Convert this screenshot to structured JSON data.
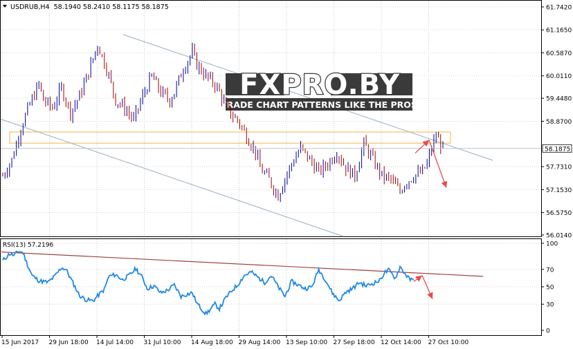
{
  "chart_data": [
    {
      "type": "candlestick",
      "symbol_header": "USDRUB,H4  58.1940 58.2410 58.1175 58.1875",
      "header_menu_icon": "triangle-down-icon",
      "current_price": 58.1875,
      "current_price_label": "58.1875",
      "y_ticks": [
        "61.7420",
        "61.1650",
        "60.5870",
        "60.0110",
        "59.4480",
        "58.8700",
        "57.7310",
        "57.1530",
        "56.5750",
        "56.0140"
      ],
      "ylim": [
        56.014,
        61.742
      ],
      "x_labels": [
        "15 Jun 2017",
        "29 Jun 18:00",
        "14 Jul 14:00",
        "31 Jul 10:00",
        "14 Aug 18:00",
        "29 Aug 14:00",
        "13 Sep 10:00",
        "27 Sep 18:00",
        "12 Oct 14:00",
        "27 Oct 10:00"
      ],
      "bull_color": "#0000a0",
      "bear_color": "#a00000",
      "grid": true,
      "close_path": [
        [
          0,
          57.5
        ],
        [
          4,
          57.9
        ],
        [
          8,
          58.7
        ],
        [
          12,
          59.3
        ],
        [
          16,
          59.8
        ],
        [
          18,
          59.4
        ],
        [
          22,
          59.2
        ],
        [
          26,
          59.7
        ],
        [
          30,
          59.1
        ],
        [
          34,
          59.5
        ],
        [
          38,
          60.1
        ],
        [
          42,
          60.8
        ],
        [
          46,
          60.2
        ],
        [
          50,
          59.4
        ],
        [
          54,
          59.2
        ],
        [
          58,
          58.9
        ],
        [
          62,
          59.5
        ],
        [
          66,
          60.0
        ],
        [
          70,
          59.6
        ],
        [
          74,
          59.4
        ],
        [
          76,
          59.6
        ],
        [
          80,
          60.2
        ],
        [
          84,
          60.6
        ],
        [
          86,
          60.3
        ],
        [
          90,
          60.0
        ],
        [
          94,
          59.8
        ],
        [
          96,
          59.6
        ],
        [
          100,
          59.1
        ],
        [
          104,
          58.9
        ],
        [
          108,
          58.5
        ],
        [
          112,
          58.1
        ],
        [
          114,
          57.7
        ],
        [
          118,
          57.4
        ],
        [
          122,
          57.0
        ],
        [
          124,
          57.3
        ],
        [
          128,
          57.8
        ],
        [
          132,
          58.2
        ],
        [
          136,
          57.9
        ],
        [
          140,
          57.6
        ],
        [
          144,
          57.8
        ],
        [
          148,
          58.1
        ],
        [
          152,
          57.7
        ],
        [
          156,
          57.5
        ],
        [
          158,
          57.9
        ],
        [
          160,
          58.3
        ],
        [
          164,
          57.9
        ],
        [
          168,
          57.5
        ],
        [
          172,
          57.4
        ],
        [
          176,
          57.1
        ],
        [
          178,
          57.3
        ],
        [
          182,
          57.5
        ],
        [
          186,
          57.6
        ],
        [
          188,
          57.8
        ],
        [
          190,
          58.2
        ],
        [
          192,
          58.5
        ],
        [
          195,
          58.2
        ]
      ],
      "candle_count": 196,
      "upper_channel": [
        [
          0,
          58.75
        ],
        [
          195,
          59.47
        ]
      ],
      "lower_channel": [
        [
          0,
          58.75
        ],
        [
          133,
          56.0
        ]
      ],
      "resistance_zone": {
        "from": 58.32,
        "to": 58.6
      },
      "resistance_zone_color": "#f5c060",
      "watermark": {
        "title": "FXPRO.BY",
        "tagline": "TRADE CHART PATTERNS LIKE THE PROS"
      },
      "forecast_color": "#e84a4a"
    },
    {
      "type": "line",
      "name_label": "RSI(13) 57.2196",
      "ylim": [
        0,
        100
      ],
      "y_ticks": [
        "100",
        "70",
        "50",
        "30",
        "0"
      ],
      "line_color": "#1e88e5",
      "trendline": [
        [
          0,
          90
        ],
        [
          195,
          62
        ]
      ],
      "trendline_color": "#a04040",
      "rsi_path": [
        [
          0,
          80
        ],
        [
          3,
          88
        ],
        [
          5,
          86
        ],
        [
          7,
          91
        ],
        [
          9,
          89
        ],
        [
          11,
          75
        ],
        [
          13,
          63
        ],
        [
          16,
          57
        ],
        [
          20,
          55
        ],
        [
          23,
          62
        ],
        [
          26,
          72
        ],
        [
          28,
          70
        ],
        [
          31,
          55
        ],
        [
          34,
          40
        ],
        [
          37,
          35
        ],
        [
          40,
          34
        ],
        [
          43,
          42
        ],
        [
          45,
          47
        ],
        [
          47,
          62
        ],
        [
          50,
          64
        ],
        [
          53,
          58
        ],
        [
          56,
          63
        ],
        [
          59,
          71
        ],
        [
          62,
          60
        ],
        [
          64,
          48
        ],
        [
          67,
          51
        ],
        [
          70,
          43
        ],
        [
          73,
          46
        ],
        [
          76,
          52
        ],
        [
          79,
          39
        ],
        [
          81,
          41
        ],
        [
          84,
          43
        ],
        [
          86,
          31
        ],
        [
          88,
          25
        ],
        [
          90,
          19
        ],
        [
          92,
          24
        ],
        [
          94,
          30
        ],
        [
          96,
          25
        ],
        [
          99,
          38
        ],
        [
          102,
          47
        ],
        [
          104,
          52
        ],
        [
          107,
          63
        ],
        [
          110,
          67
        ],
        [
          113,
          61
        ],
        [
          116,
          55
        ],
        [
          119,
          63
        ],
        [
          122,
          50
        ],
        [
          125,
          39
        ],
        [
          128,
          56
        ],
        [
          131,
          52
        ],
        [
          134,
          48
        ],
        [
          137,
          50
        ],
        [
          140,
          70
        ],
        [
          143,
          58
        ],
        [
          146,
          43
        ],
        [
          149,
          34
        ],
        [
          152,
          44
        ],
        [
          155,
          48
        ],
        [
          158,
          55
        ],
        [
          161,
          51
        ],
        [
          164,
          54
        ],
        [
          167,
          57
        ],
        [
          169,
          66
        ],
        [
          171,
          69
        ],
        [
          174,
          60
        ],
        [
          176,
          73
        ],
        [
          178,
          66
        ],
        [
          180,
          59
        ],
        [
          182,
          57
        ]
      ],
      "forecast_color": "#e84a4a"
    }
  ]
}
